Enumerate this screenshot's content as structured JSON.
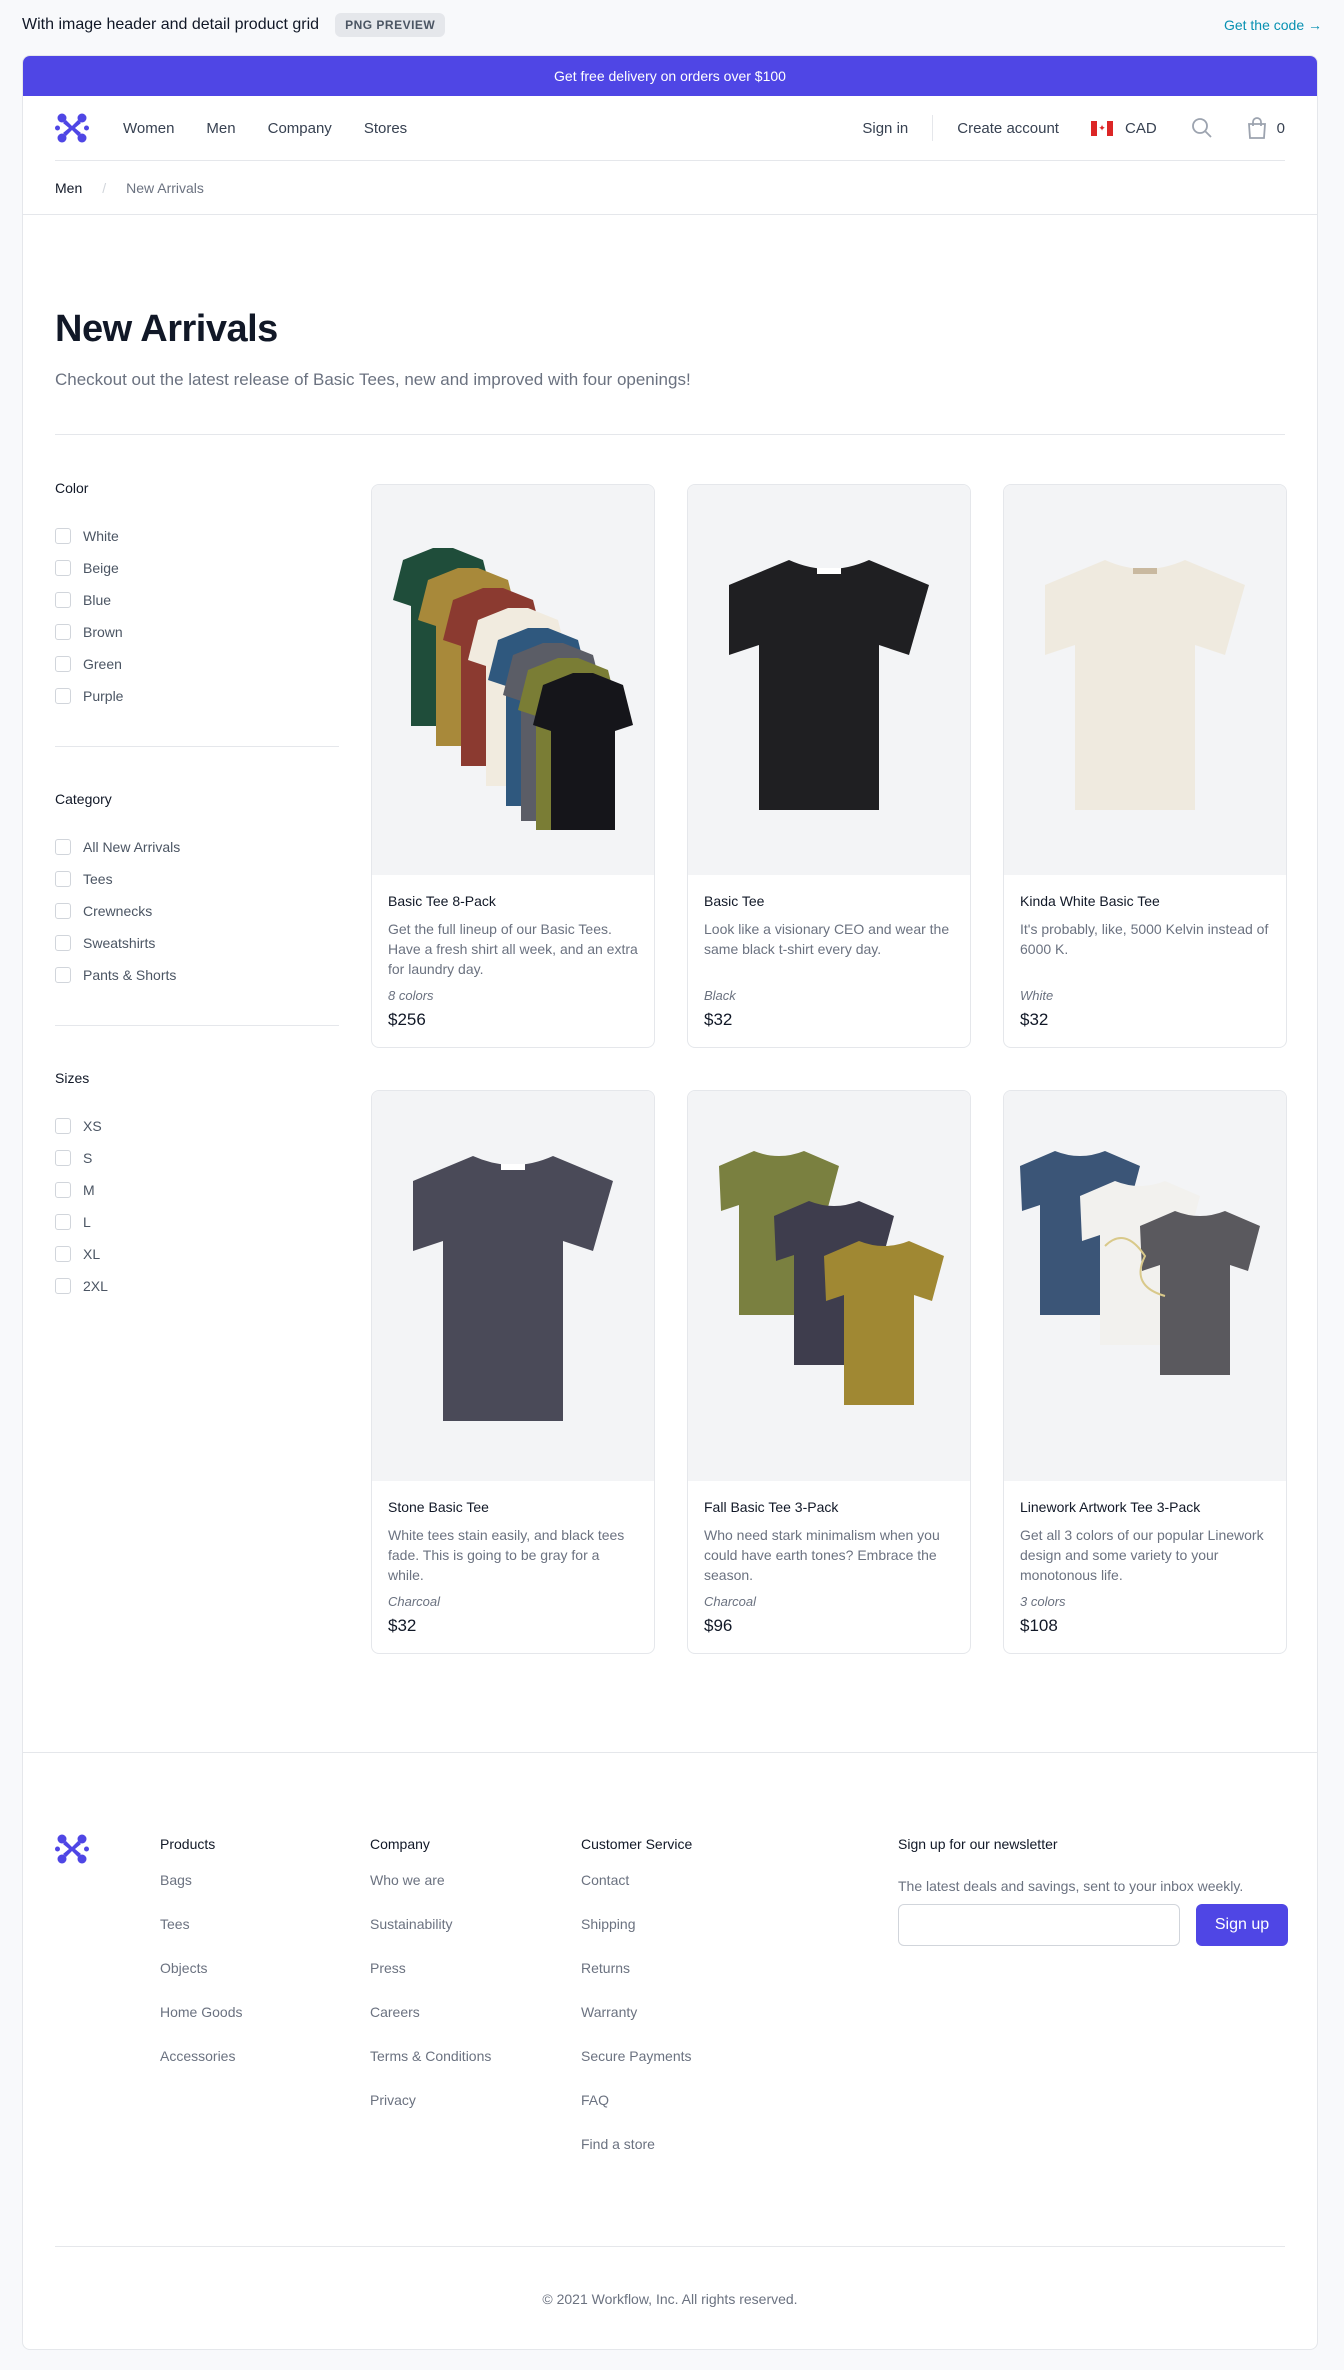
{
  "preview": {
    "title": "With image header and detail product grid",
    "badge": "PNG PREVIEW",
    "link": "Get the code →"
  },
  "promo": "Get free delivery on orders over $100",
  "nav": {
    "links": [
      "Women",
      "Men",
      "Company",
      "Stores"
    ],
    "sign_in": "Sign in",
    "create_account": "Create account",
    "currency": "CAD",
    "cart_count": "0"
  },
  "breadcrumb": [
    "Men",
    "New Arrivals"
  ],
  "hero": {
    "title": "New Arrivals",
    "lead": "Checkout out the latest release of Basic Tees, new and improved with four openings!"
  },
  "filters": {
    "color": {
      "title": "Color",
      "options": [
        "White",
        "Beige",
        "Blue",
        "Brown",
        "Green",
        "Purple"
      ]
    },
    "category": {
      "title": "Category",
      "options": [
        "All New Arrivals",
        "Tees",
        "Crewnecks",
        "Sweatshirts",
        "Pants & Shorts"
      ]
    },
    "sizes": {
      "title": "Sizes",
      "options": [
        "XS",
        "S",
        "M",
        "L",
        "XL",
        "2XL"
      ]
    }
  },
  "products": [
    {
      "name": "Basic Tee 8-Pack",
      "desc": "Get the full lineup of our Basic Tees. Have a fresh shirt all week, and an extra for laundry day.",
      "opt": "8 colors",
      "price": "$256"
    },
    {
      "name": "Basic Tee",
      "desc": "Look like a visionary CEO and wear the same black t-shirt every day.",
      "opt": "Black",
      "price": "$32"
    },
    {
      "name": "Kinda White Basic Tee",
      "desc": "It's probably, like, 5000 Kelvin instead of 6000 K.",
      "opt": "White",
      "price": "$32"
    },
    {
      "name": "Stone Basic Tee",
      "desc": "White tees stain easily, and black tees fade. This is going to be gray for a while.",
      "opt": "Charcoal",
      "price": "$32"
    },
    {
      "name": "Fall Basic Tee 3-Pack",
      "desc": "Who need stark minimalism when you could have earth tones? Embrace the season.",
      "opt": "Charcoal",
      "price": "$96"
    },
    {
      "name": "Linework Artwork Tee 3-Pack",
      "desc": "Get all 3 colors of our popular Linework design and some variety to your monotonous life.",
      "opt": "3 colors",
      "price": "$108"
    }
  ],
  "footer": {
    "products": {
      "title": "Products",
      "links": [
        "Bags",
        "Tees",
        "Objects",
        "Home Goods",
        "Accessories"
      ]
    },
    "company": {
      "title": "Company",
      "links": [
        "Who we are",
        "Sustainability",
        "Press",
        "Careers",
        "Terms & Conditions",
        "Privacy"
      ]
    },
    "service": {
      "title": "Customer Service",
      "links": [
        "Contact",
        "Shipping",
        "Returns",
        "Warranty",
        "Secure Payments",
        "FAQ",
        "Find a store"
      ]
    },
    "newsletter": {
      "title": "Sign up for our newsletter",
      "text": "The latest deals and savings, sent to your inbox weekly.",
      "button": "Sign up"
    },
    "copyright": "© 2021 Workflow, Inc. All rights reserved."
  },
  "colors": {
    "brand": "#4f46e5",
    "link": "#0891b2"
  }
}
